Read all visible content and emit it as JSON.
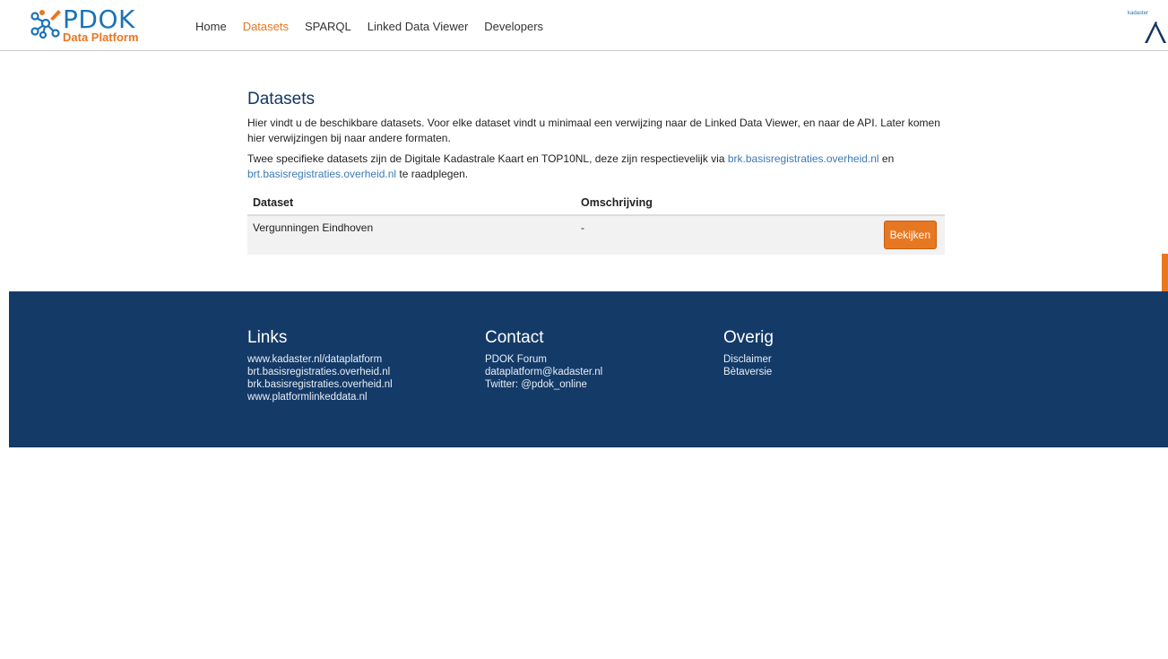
{
  "header": {
    "logo_title": "PDOK",
    "logo_subtitle": "Data Platform",
    "nav": [
      {
        "label": "Home",
        "active": false
      },
      {
        "label": "Datasets",
        "active": true
      },
      {
        "label": "SPARQL",
        "active": false
      },
      {
        "label": "Linked Data Viewer",
        "active": false
      },
      {
        "label": "Developers",
        "active": false
      }
    ],
    "kadaster_label": "kadaster"
  },
  "main": {
    "title": "Datasets",
    "intro": "Hier vindt u de beschikbare datasets. Voor elke dataset vindt u minimaal een verwijzing naar de Linked Data Viewer, en naar de API. Later komen hier verwijzingen bij naar andere formaten.",
    "specific_prefix": "Twee specifieke datasets zijn de Digitale Kadastrale Kaart en TOP10NL, deze zijn respectievelijk via ",
    "link_brk": "brk.basisregistraties.overheid.nl",
    "specific_middle": " en ",
    "link_brt": "brt.basisregistraties.overheid.nl",
    "specific_suffix": " te raadplegen.",
    "table": {
      "headers": [
        "Dataset",
        "Omschrijving"
      ],
      "rows": [
        {
          "dataset": "Vergunningen Eindhoven",
          "description": "-",
          "action": "Bekijken"
        }
      ]
    }
  },
  "footer": {
    "links": {
      "title": "Links",
      "items": [
        "www.kadaster.nl/dataplatform",
        "brt.basisregistraties.overheid.nl",
        "brk.basisregistraties.overheid.nl",
        "www.platformlinkeddata.nl"
      ]
    },
    "contact": {
      "title": "Contact",
      "items": [
        "PDOK Forum",
        "dataplatform@kadaster.nl",
        "Twitter: @pdok_online"
      ]
    },
    "overig": {
      "title": "Overig",
      "items": [
        "Disclaimer",
        "Bètaversie"
      ]
    }
  },
  "colors": {
    "accent": "#e87722",
    "brand_blue": "#1a73b8",
    "footer_bg": "#143a68"
  }
}
